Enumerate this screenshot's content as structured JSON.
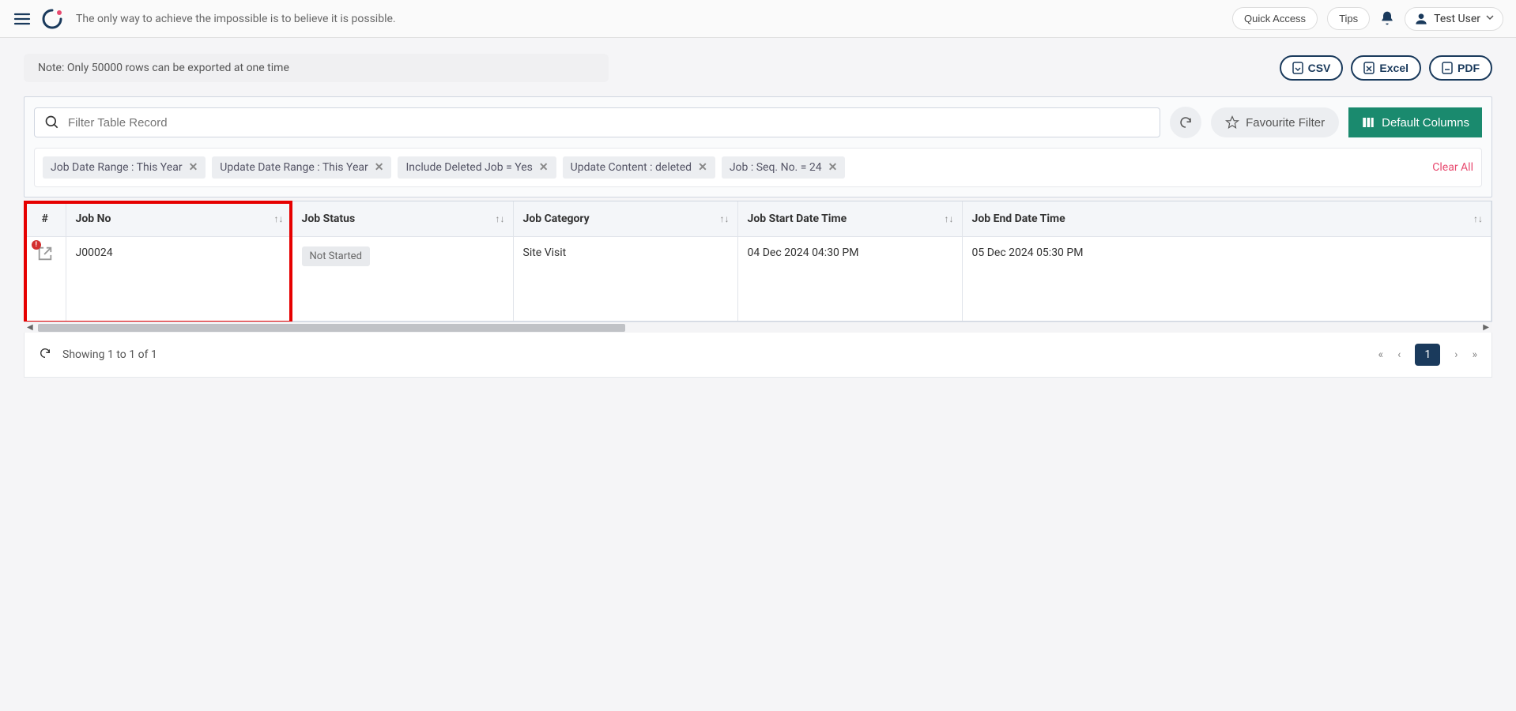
{
  "header": {
    "tagline": "The only way to achieve the impossible is to believe it is possible.",
    "quick_access": "Quick Access",
    "tips": "Tips",
    "user_name": "Test User"
  },
  "note": "Note: Only 50000 rows can be exported at one time",
  "export": {
    "csv": "CSV",
    "excel": "Excel",
    "pdf": "PDF"
  },
  "search": {
    "placeholder": "Filter Table Record"
  },
  "fav_filter": "Favourite Filter",
  "default_cols": "Default Columns",
  "chips": [
    "Job Date Range  :  This Year",
    "Update Date Range  :  This Year",
    "Include Deleted Job  =  Yes",
    "Update Content  :  deleted",
    "Job : Seq. No.  =  24"
  ],
  "clear_all": "Clear All",
  "columns": {
    "hash": "#",
    "job_no": "Job No",
    "job_status": "Job Status",
    "job_category": "Job Category",
    "start": "Job Start Date Time",
    "end": "Job End Date Time"
  },
  "row": {
    "job_no": "J00024",
    "status": "Not Started",
    "category": "Site Visit",
    "start": "04 Dec 2024 04:30 PM",
    "end": "05 Dec 2024 05:30 PM"
  },
  "pager": {
    "info": "Showing 1 to 1 of 1",
    "page": "1"
  }
}
